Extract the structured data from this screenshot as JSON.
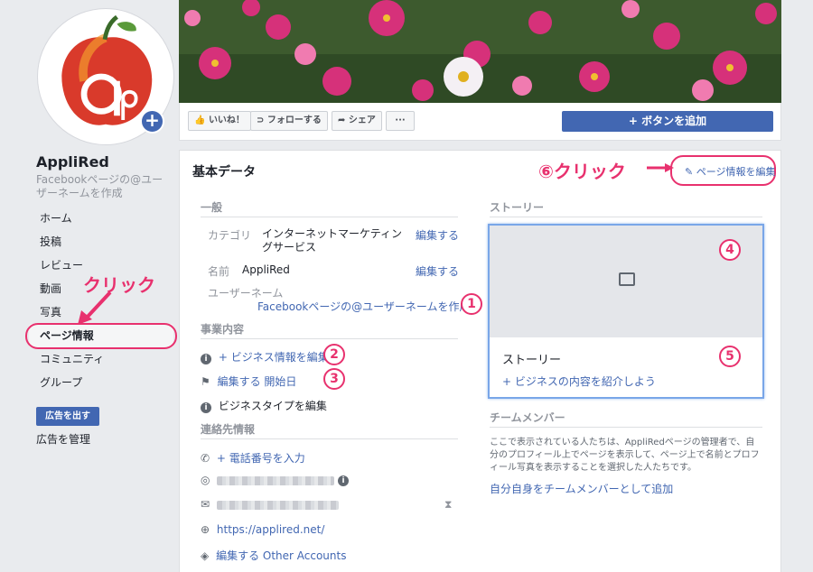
{
  "page": {
    "name": "AppliRed",
    "username_prompt": "Facebookページの@ユーザーネームを作成"
  },
  "nav": [
    {
      "label": "ホーム"
    },
    {
      "label": "投稿"
    },
    {
      "label": "レビュー"
    },
    {
      "label": "動画"
    },
    {
      "label": "写真"
    },
    {
      "label": "ページ情報"
    },
    {
      "label": "コミュニティ"
    },
    {
      "label": "グループ"
    }
  ],
  "ads": {
    "create": "広告を出す",
    "manage": "広告を管理"
  },
  "toolbar": {
    "like": "いいね！",
    "follow": "フォローする",
    "share": "シェア",
    "more": "···",
    "add_button": "+ ボタンを追加"
  },
  "about": {
    "title": "基本データ",
    "edit_page_info": "ページ情報を編集",
    "general": {
      "heading": "一般",
      "category_label": "カテゴリ",
      "category_value": "インターネットマーケティングサービス",
      "name_label": "名前",
      "name_value": "AppliRed",
      "edit": "編集する",
      "username_label": "ユーザーネーム",
      "username_link": "Facebookページの@ユーザーネームを作成"
    },
    "business": {
      "heading": "事業内容",
      "biz_info": "+ ビジネス情報を編集",
      "start_date": "編集する 開始日",
      "biz_type": "ビジネスタイプを編集"
    },
    "contact": {
      "heading": "連絡先情報",
      "phone": "+ 電話番号を入力",
      "website": "https://applired.net/",
      "other": "編集する Other Accounts"
    },
    "story": {
      "heading": "ストーリー",
      "title": "ストーリー",
      "add": "+ ビジネスの内容を紹介しよう"
    },
    "team": {
      "heading": "チームメンバー",
      "desc": "ここで表示されている人たちは、AppliRedページの管理者で、自分のプロフィール上でページを表示して、ページ上で名前とプロフィール写真を表示することを選択した人たちです。",
      "link": "自分自身をチームメンバーとして追加"
    }
  },
  "annotations": {
    "click": "クリック",
    "click6": "⑥クリック",
    "n1": "1",
    "n2": "2",
    "n3": "3",
    "n4": "4",
    "n5": "5"
  },
  "colors": {
    "accent": "#4267b2",
    "annotation": "#e8316e"
  }
}
